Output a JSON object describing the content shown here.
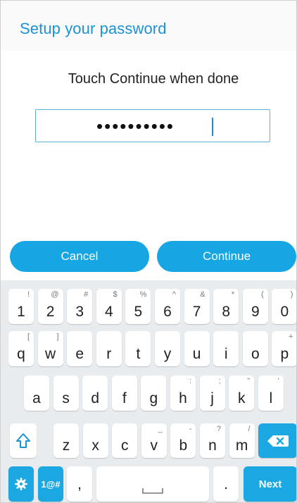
{
  "header": {
    "title": "Setup your password"
  },
  "main": {
    "instruction": "Touch Continue when done",
    "password_mask": "••••••••••"
  },
  "buttons": {
    "cancel": "Cancel",
    "continue": "Continue"
  },
  "keyboard": {
    "row1": [
      {
        "key": "1",
        "hint": "!"
      },
      {
        "key": "2",
        "hint": "@"
      },
      {
        "key": "3",
        "hint": "#"
      },
      {
        "key": "4",
        "hint": "$"
      },
      {
        "key": "5",
        "hint": "%"
      },
      {
        "key": "6",
        "hint": "^"
      },
      {
        "key": "7",
        "hint": "&"
      },
      {
        "key": "8",
        "hint": "*"
      },
      {
        "key": "9",
        "hint": "("
      },
      {
        "key": "0",
        "hint": ")"
      }
    ],
    "row2": [
      {
        "key": "q",
        "hint": "["
      },
      {
        "key": "w",
        "hint": "]"
      },
      {
        "key": "e",
        "hint": ""
      },
      {
        "key": "r",
        "hint": ""
      },
      {
        "key": "t",
        "hint": ""
      },
      {
        "key": "y",
        "hint": ""
      },
      {
        "key": "u",
        "hint": ""
      },
      {
        "key": "i",
        "hint": ""
      },
      {
        "key": "o",
        "hint": ""
      },
      {
        "key": "p",
        "hint": "+"
      }
    ],
    "row3": [
      {
        "key": "a",
        "hint": ""
      },
      {
        "key": "s",
        "hint": ""
      },
      {
        "key": "d",
        "hint": ""
      },
      {
        "key": "f",
        "hint": ""
      },
      {
        "key": "g",
        "hint": ""
      },
      {
        "key": "h",
        "hint": ":"
      },
      {
        "key": "j",
        "hint": ";"
      },
      {
        "key": "k",
        "hint": "\""
      },
      {
        "key": "l",
        "hint": "'"
      }
    ],
    "row4": [
      {
        "key": "z",
        "hint": ""
      },
      {
        "key": "x",
        "hint": ""
      },
      {
        "key": "c",
        "hint": ""
      },
      {
        "key": "v",
        "hint": "_"
      },
      {
        "key": "b",
        "hint": "-"
      },
      {
        "key": "n",
        "hint": "?"
      },
      {
        "key": "m",
        "hint": "/"
      }
    ],
    "symbols_label": "1@#",
    "comma": ",",
    "period": ".",
    "next_label": "Next",
    "icons": {
      "shift": "shift-icon",
      "backspace": "backspace-icon",
      "settings": "settings-gear-icon",
      "space": "space-bar-icon"
    }
  },
  "colors": {
    "accent": "#1a93d6",
    "button": "#16a6e4",
    "keyboard_bg": "#e9ecef"
  }
}
